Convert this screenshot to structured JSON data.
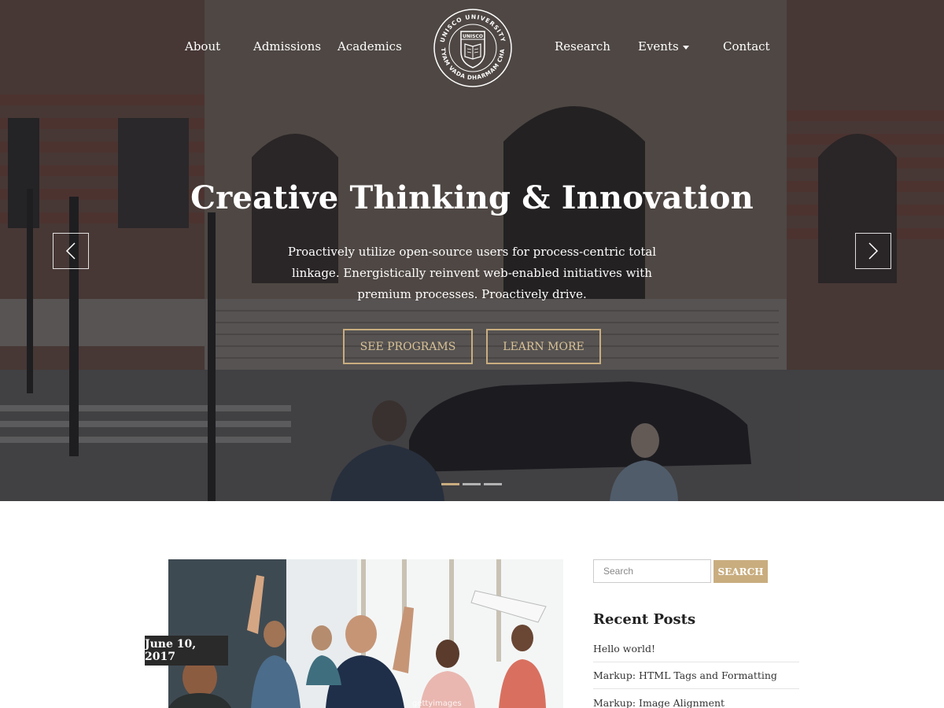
{
  "nav": {
    "left_items": [
      "About",
      "Admissions",
      "Academics"
    ],
    "right_items": [
      "Research",
      "Events",
      "Contact"
    ]
  },
  "logo": {
    "text_top": "UNISCO UNIVERSITY",
    "text_bottom": "SATYAM VADA DHARMAM CHARA",
    "shield_text": "UNISCO"
  },
  "hero": {
    "title": "Creative Thinking & Innovation",
    "text": "Proactively utilize open-source users for process-centric total linkage. Energistically reinvent web-enabled initiatives with premium processes. Proactively drive.",
    "primary_button": "SEE PROGRAMS",
    "secondary_button": "LEARN MORE",
    "slides_total": 3,
    "slide_active": 1
  },
  "post": {
    "date": "June 10, 2017",
    "image_credit": "gettyimages"
  },
  "sidebar": {
    "search_placeholder": "Search",
    "search_button": "SEARCH",
    "recent_posts_title": "Recent Posts",
    "recent_posts": [
      "Hello world!",
      "Markup: HTML Tags and Formatting",
      "Markup: Image Alignment"
    ]
  },
  "colors": {
    "accent": "#c9ad7f",
    "dark": "#2a2a2a"
  }
}
